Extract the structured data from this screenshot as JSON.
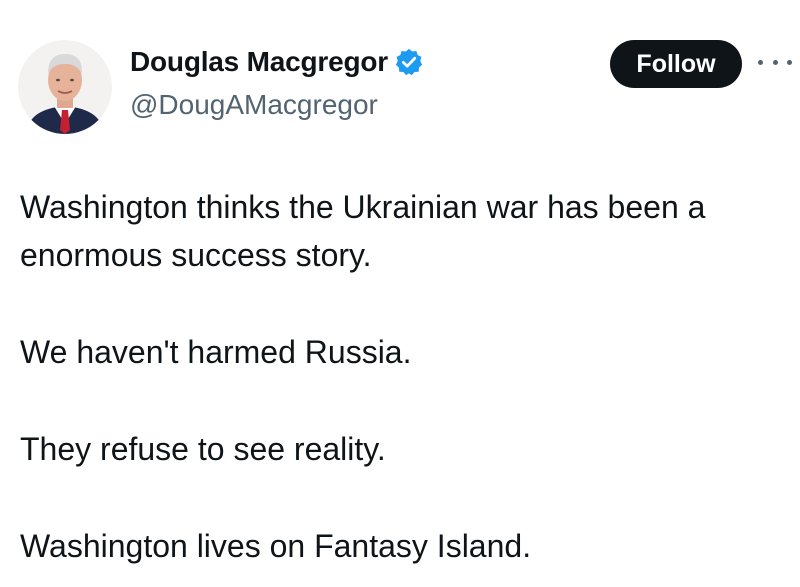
{
  "author": {
    "display_name": "Douglas Macgregor",
    "handle": "@DougAMacgregor",
    "verified_icon": "verified-badge-icon",
    "avatar_icon": "avatar"
  },
  "actions": {
    "follow_label": "Follow",
    "more_icon": "more-options-icon"
  },
  "tweet": {
    "lines": [
      "Washington thinks the Ukrainian war has been a",
      "enormous success story.",
      "We haven't harmed Russia.",
      "They refuse to see reality.",
      "Washington lives on Fantasy Island."
    ]
  },
  "colors": {
    "text": "#0f1419",
    "secondary": "#536471",
    "follow_bg": "#0f1419",
    "verified": "#1d9bf0"
  }
}
